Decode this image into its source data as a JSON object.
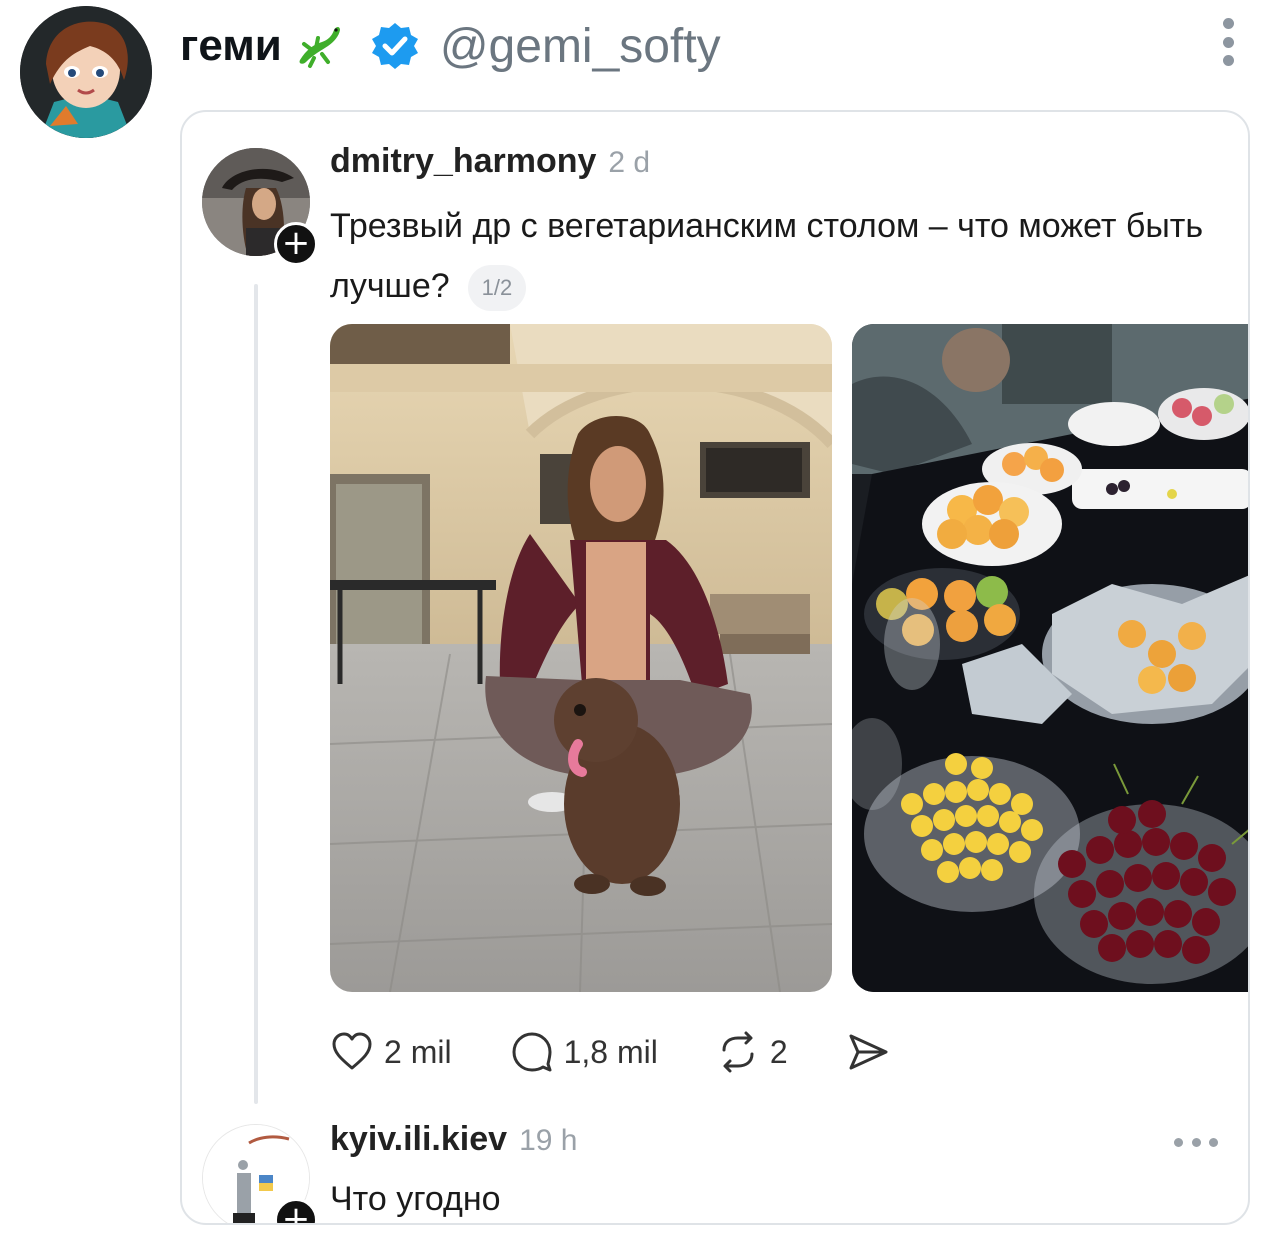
{
  "outer": {
    "display_name": "геми",
    "handle": "@gemi_softy",
    "icons": [
      "lizard-icon",
      "verified-icon",
      "more-vertical-icon"
    ]
  },
  "post": {
    "username": "dmitry_harmony",
    "time": "2 d",
    "text": "Трезвый др с вегетарианским столом – что может быть лучше?",
    "pager": "1/2",
    "actions": {
      "likes": "2 mil",
      "comments": "1,8 mil",
      "reposts": "2"
    }
  },
  "reply": {
    "username": "kyiv.ili.kiev",
    "time": "19 h",
    "text": "Что угодно"
  },
  "colors": {
    "verified": "#1d9bf0",
    "lizard": "#3fae2a",
    "muted": "#9aa1a8"
  }
}
